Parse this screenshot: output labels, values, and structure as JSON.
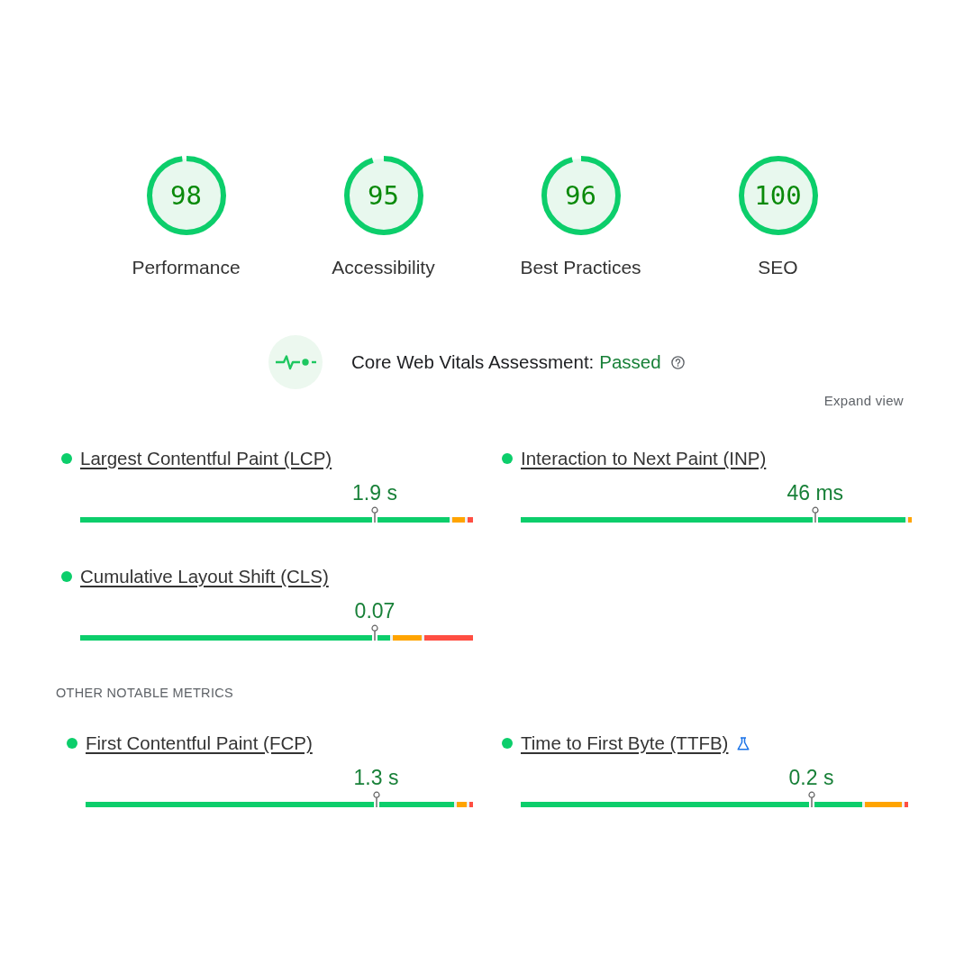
{
  "categories": [
    {
      "score": "98",
      "label": "Performance",
      "level": 0.98
    },
    {
      "score": "95",
      "label": "Accessibility",
      "level": 0.95
    },
    {
      "score": "96",
      "label": "Best Practices",
      "level": 0.96
    },
    {
      "score": "100",
      "label": "SEO",
      "level": 1
    }
  ],
  "assessment": {
    "title": "Core Web Vitals Assessment:",
    "result": "Passed"
  },
  "expand_view": "Expand view",
  "metrics": [
    {
      "name": "Largest Contentful Paint (LCP)",
      "color": "#0cce6b",
      "value": "1.9 s",
      "marker": {
        "level": 0.75
      },
      "segments": [
        {
          "color": "#0cce6b",
          "level": 0.94
        },
        {
          "color": "#ffa400"
        },
        {
          "color": "#ff4e42",
          "level": 0.013
        }
      ]
    },
    {
      "name": "Interaction to Next Paint (INP)",
      "color": "#0cce6b",
      "value": "46 ms",
      "marker": {
        "level": 0.753
      },
      "segments": [
        {
          "color": "#0cce6b",
          "level": 0.984
        },
        {
          "color": "#ffa400"
        }
      ]
    },
    {
      "name": "Cumulative Layout Shift (CLS)",
      "color": "#0cce6b",
      "value": "0.07",
      "marker": {
        "level": 0.75
      },
      "segments": [
        {
          "color": "#0cce6b",
          "level": 0.79
        },
        {
          "color": "#ffa400"
        },
        {
          "color": "#ff4e42",
          "level": 0.124
        }
      ]
    }
  ],
  "other_metrics": {
    "heading": "OTHER NOTABLE METRICS",
    "metrics": [
      {
        "name": "First Contentful Paint (FCP)",
        "color": "#0cce6b",
        "flask_icon": false,
        "value": "1.3 s",
        "marker": {
          "level": 0.75
        },
        "segments": [
          {
            "color": "#0cce6b",
            "level": 0.951
          },
          {
            "color": "#ffa400"
          },
          {
            "color": "#ff4e42",
            "level": 0.009
          }
        ]
      },
      {
        "name": "Time to First Byte (TTFB)",
        "color": "#0cce6b",
        "flask_icon": true,
        "value": "0.2 s",
        "marker": {
          "level": 0.75
        },
        "segments": [
          {
            "color": "#0cce6b",
            "level": 0.881
          },
          {
            "color": "#ffa400"
          },
          {
            "color": "#ff4e42",
            "level": 0.009
          }
        ]
      }
    ]
  }
}
